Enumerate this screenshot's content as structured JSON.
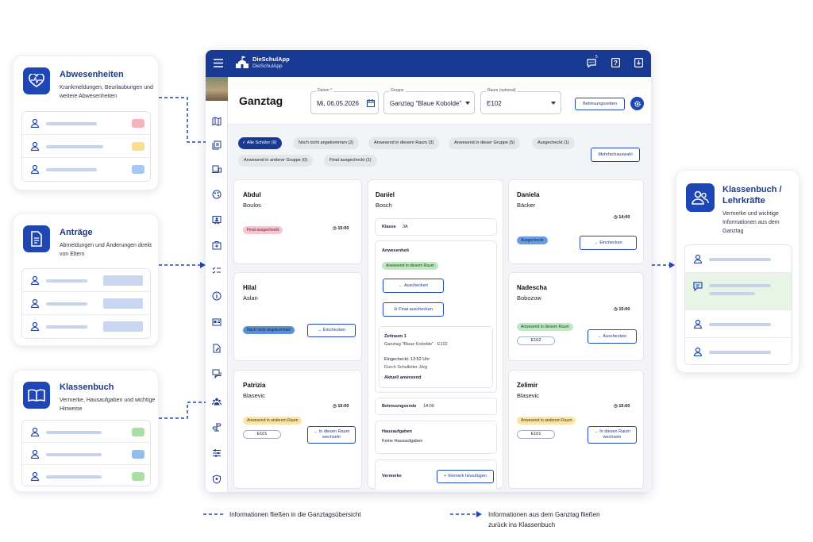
{
  "panels": {
    "absences": {
      "title": "Abwesenheiten",
      "subtitle": "Krankmeldungen, Beurlaubungen und weitere Abwesenheiten",
      "pill_colors": [
        "#f6b3bb",
        "#f7df8b",
        "#a9c6f3"
      ]
    },
    "requests": {
      "title": "Anträge",
      "subtitle": "Abmeldungen und Änderungen direkt von Eltern"
    },
    "classbook": {
      "title": "Klassenbuch",
      "subtitle": "Vermerke, Hausaufgaben und wichtige Hinweise",
      "pill_colors": [
        "#a6e0a4",
        "#93bdf0",
        "#a6e0a4"
      ]
    },
    "teachers": {
      "title": "Klassenbuch / Lehrkräfte",
      "subtitle": "Vermerke und wichtige Informationen aus dem Ganztag"
    }
  },
  "app": {
    "name": "DieSchulApp",
    "name2": "DieSchulApp",
    "badge": "5",
    "page_title": "Ganztag",
    "date": {
      "label": "Datum *",
      "value": "Mi, 06.05.2026"
    },
    "group": {
      "label": "Gruppe",
      "value": "Ganztag \"Blaue Kobolde\""
    },
    "room": {
      "label": "Raum (optional)",
      "value": "E102"
    },
    "btn_times": "Betreuungszeiten",
    "filters": [
      "Alle Schüler (9)",
      "Noch nicht angekommen (2)",
      "Anwesend in diesem Raum (3)",
      "Anwesend in dieser Gruppe (5)",
      "Ausgecheckt (1)",
      "Anwesend in anderer Gruppe (0)",
      "Final ausgecheckt (1)"
    ],
    "multi": "Mehrfachauswahl"
  },
  "students": {
    "abdul": {
      "first": "Abdul",
      "last": "Boulos",
      "tag": "Final ausgecheckt",
      "time": "15:00"
    },
    "hilal": {
      "first": "Hilal",
      "last": "Aslan",
      "tag": "Noch nicht angekommen",
      "btn": "Einchecken"
    },
    "patrizia": {
      "first": "Patrizia",
      "last": "Blasevic",
      "time": "15:00",
      "tag": "Anwesend in anderem Raum",
      "room": "E101",
      "btn": "In diesen Raum wechseln"
    },
    "daniel": {
      "first": "Daniel",
      "last": "Bosch",
      "klasse_label": "Klasse",
      "klasse": "3A",
      "anw_title": "Anwesenheit",
      "anw_tag": "Anwesend in diesem Raum",
      "btn_out": "Auschecken",
      "btn_final": "Final auschecken",
      "zeitraum": "Zeitraum 1",
      "zeitraum_sub": "Ganztag \"Blaue Kobolde\" · E102",
      "checked_in": "Eingecheckt: 12:52 Uhr",
      "by": "Durch Schulleiter Jörg",
      "present": "Aktuell anwesend",
      "end_label": "Betreuungsende",
      "end": "14:00",
      "hw_title": "Hausaufgaben",
      "hw": "Keine Hausaufgaben",
      "notes": "Vermerke",
      "add_note": "Vermerk hinzufügen"
    },
    "daniela": {
      "first": "Daniela",
      "last": "Bäcker",
      "time": "14:00",
      "tag": "Ausgecheckt",
      "btn": "Einchecken"
    },
    "nadescha": {
      "first": "Nadescha",
      "last": "Bobozow",
      "time": "15:00",
      "tag": "Anwesend in diesem Raum",
      "room": "E102",
      "btn": "Auschecken"
    },
    "zelimir": {
      "first": "Zelimir",
      "last": "Blasevic",
      "time": "15:00",
      "tag": "Anwesend in anderem Raum",
      "room": "E101",
      "btn": "In diesen Raum wechseln"
    }
  },
  "legend": {
    "left": "Informationen fließen in die Ganztagsübersicht",
    "right": "Informationen aus dem Ganztag fließen zurück ins Klassenbuch"
  }
}
